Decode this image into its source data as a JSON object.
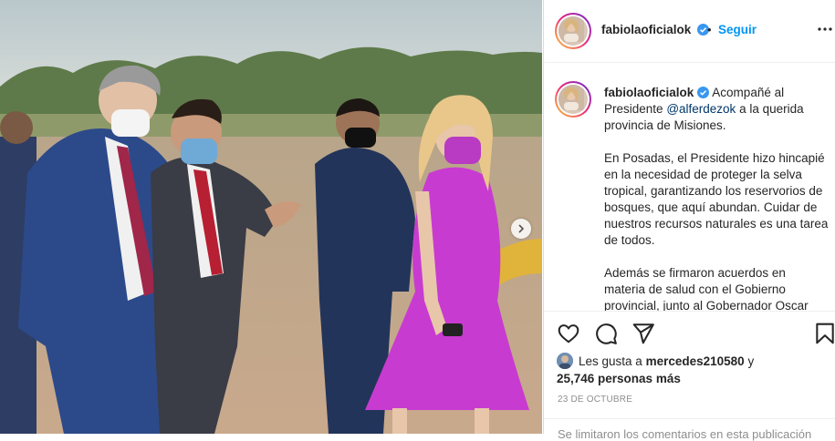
{
  "post": {
    "username": "fabiolaoficialok",
    "separator": "•",
    "follow_label": "Seguir",
    "caption": {
      "lead": "Acompañé al Presidente",
      "mention": "@alferdezok",
      "tail": "a la querida provincia de Misiones.",
      "paragraph2": "En Posadas, el Presidente hizo hincapié en la necesidad de proteger la selva tropical, garantizando los reservorios de bosques, que aquí abundan. Cuidar de nuestros recursos naturales es una tarea de todos.",
      "paragraph3": "Además se firmaron acuerdos en materia de salud con el Gobierno provincial, junto al Gobernador Oscar"
    },
    "likes": {
      "prefix": "Les gusta a",
      "user": "mercedes210580",
      "conjunction": "y",
      "count": "25,746 personas más"
    },
    "date": "23 DE OCTUBRE",
    "comments_note": "Se limitaron los comentarios en esta publicación"
  },
  "icons": {
    "verified": "verified-badge-icon",
    "more": "more-options-icon",
    "like": "heart-icon",
    "comment": "comment-icon",
    "share": "send-icon",
    "save": "bookmark-icon",
    "next": "chevron-right-icon"
  },
  "colors": {
    "accent": "#0095f6",
    "mention": "#00376b",
    "verified": "#3897f0",
    "dress": "#c83bd1"
  }
}
